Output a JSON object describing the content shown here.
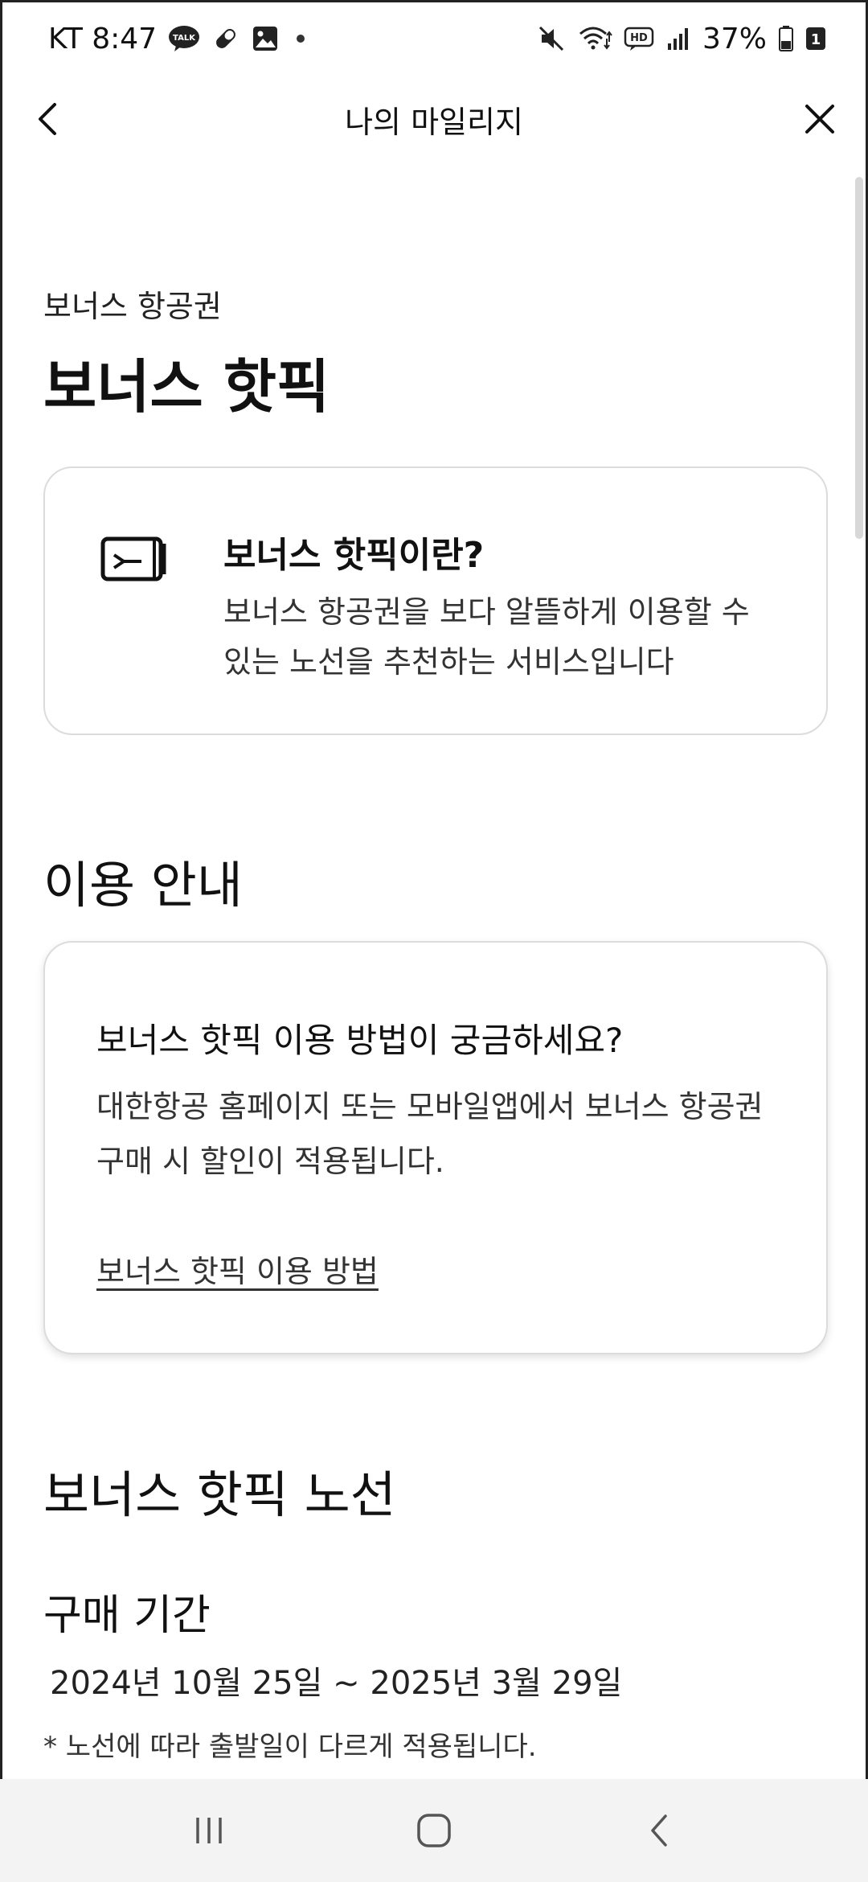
{
  "status_bar": {
    "carrier_time": "KT 8:47",
    "talk_badge": "TALK",
    "hd_badge": "HD",
    "battery": "37%",
    "sim": "1"
  },
  "header": {
    "title": "나의 마일리지"
  },
  "page": {
    "subtitle": "보너스 항공권",
    "title": "보너스 핫픽"
  },
  "intro_card": {
    "title": "보너스 핫픽이란?",
    "description": "보너스 항공권을 보다 알뜰하게 이용할 수 있는 노선을 추천하는 서비스입니다"
  },
  "guide": {
    "section_title": "이용 안내",
    "question": "보너스 핫픽 이용 방법이 궁금하세요?",
    "description": "대한항공 홈페이지 또는 모바일앱에서 보너스 항공권 구매 시 할인이 적용됩니다.",
    "link": "보너스 핫픽 이용 방법"
  },
  "routes": {
    "section_title": "보너스 핫픽 노선",
    "purchase_label": "구매 기간",
    "purchase_dates": "2024년 10월 25일 ~ 2025년 3월 29일",
    "footnote": "* 노선에 따라 출발일이 다르게 적용됩니다."
  },
  "icons": {
    "back": "back-arrow-icon",
    "close": "close-icon",
    "ticket": "ticket-icon",
    "talk": "kakaotalk-icon",
    "mute": "mute-icon",
    "wifi": "wifi-icon",
    "signal": "signal-icon",
    "battery": "battery-icon"
  }
}
